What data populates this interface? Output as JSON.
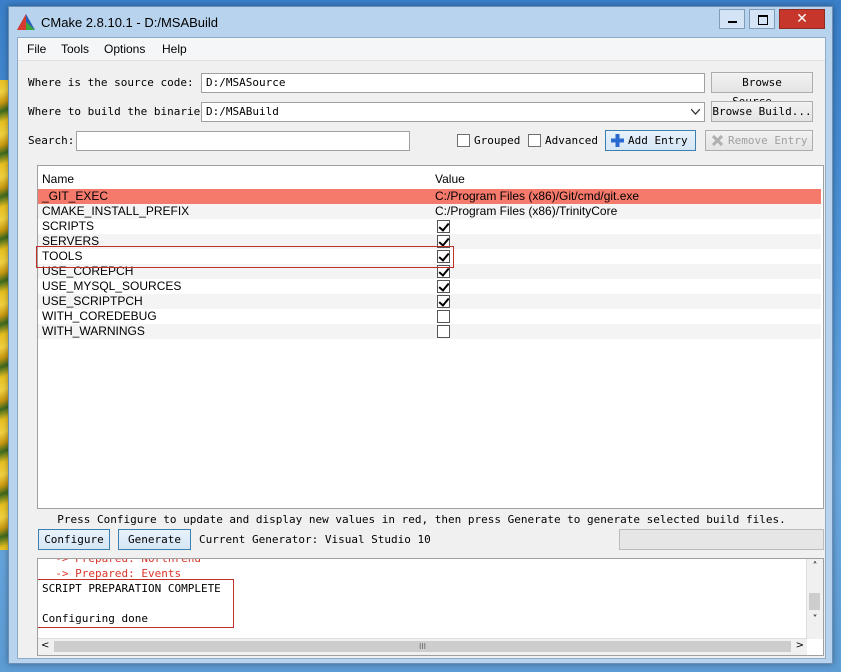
{
  "window": {
    "title": "CMake 2.8.10.1 - D:/MSABuild",
    "close_glyph": "✕"
  },
  "menu": [
    "File",
    "Tools",
    "Options",
    "Help"
  ],
  "source": {
    "label": "Where is the source code:",
    "value": "D:/MSASource",
    "browse_label": "Browse Source..."
  },
  "binaries": {
    "label": "Where to build the binaries:",
    "value": "D:/MSABuild",
    "browse_label": "Browse Build..."
  },
  "search": {
    "label": "Search:",
    "value": "",
    "grouped_label": "Grouped",
    "grouped_checked": false,
    "advanced_label": "Advanced",
    "advanced_checked": false,
    "add_entry_label": "Add Entry",
    "remove_entry_label": "Remove Entry"
  },
  "table": {
    "columns": [
      "Name",
      "Value"
    ],
    "rows": [
      {
        "name": "_GIT_EXEC",
        "value": "C:/Program Files (x86)/Git/cmd/git.exe",
        "type": "text",
        "highlight": true
      },
      {
        "name": "CMAKE_INSTALL_PREFIX",
        "value": "C:/Program Files (x86)/TrinityCore",
        "type": "text"
      },
      {
        "name": "SCRIPTS",
        "checked": true,
        "type": "bool"
      },
      {
        "name": "SERVERS",
        "checked": true,
        "type": "bool"
      },
      {
        "name": "TOOLS",
        "checked": true,
        "type": "bool"
      },
      {
        "name": "USE_COREPCH",
        "checked": true,
        "type": "bool"
      },
      {
        "name": "USE_MYSQL_SOURCES",
        "checked": true,
        "type": "bool"
      },
      {
        "name": "USE_SCRIPTPCH",
        "checked": true,
        "type": "bool"
      },
      {
        "name": "WITH_COREDEBUG",
        "checked": false,
        "type": "bool"
      },
      {
        "name": "WITH_WARNINGS",
        "checked": false,
        "type": "bool"
      }
    ]
  },
  "hint": "Press Configure to update and display new values in red, then press Generate to generate selected build files.",
  "actions": {
    "configure_label": "Configure",
    "generate_label": "Generate",
    "generator_text": "Current Generator: Visual Studio 10"
  },
  "log": {
    "lines": [
      {
        "text": "  -> Prepared: Northrend",
        "red": true
      },
      {
        "text": "  -> Prepared: Events",
        "red": true
      },
      {
        "text": "SCRIPT PREPARATION COMPLETE",
        "red": false
      },
      {
        "text": "",
        "red": false
      },
      {
        "text": "Configuring done",
        "red": false
      }
    ],
    "scroll_up": "˄",
    "scroll_down": "˅",
    "scroll_left": "<",
    "scroll_right": ">",
    "scroll_grip": "III"
  },
  "colors": {
    "highlight_row": "#f67a6c",
    "log_red": "#d9372b",
    "annotation_box": "#c0302a"
  }
}
